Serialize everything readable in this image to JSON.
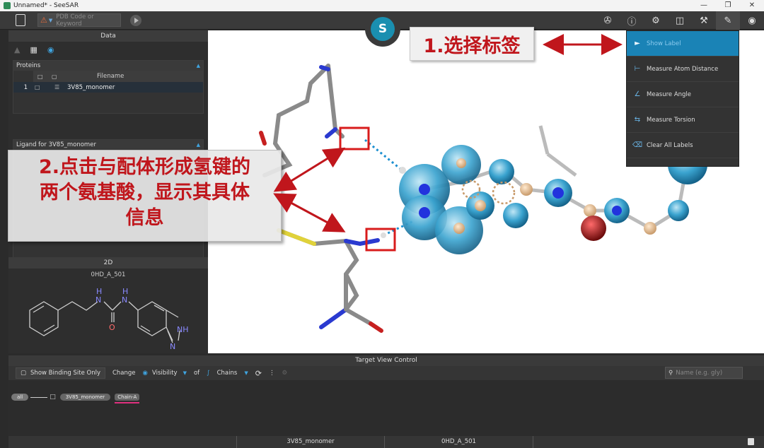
{
  "window": {
    "title": "Unnamed* - SeeSAR"
  },
  "toolbar": {
    "search_placeholder": "PDB Code or Keyword",
    "center_logo_glyph": "S"
  },
  "data_panel": {
    "header": "Data",
    "proteins": {
      "title": "Proteins",
      "col_filename": "Filename",
      "rows": [
        {
          "index": "1",
          "filename": "3V85_monomer"
        }
      ]
    },
    "ligand": {
      "title": "Ligand for 3V85_monomer"
    }
  },
  "twod_panel": {
    "header": "2D",
    "molecule_name": "0HD_A_501",
    "atoms": {
      "n1": "N",
      "h1": "H",
      "n2": "N",
      "h2": "H",
      "o": "O",
      "nh": "NH",
      "n3": "N"
    }
  },
  "menu": {
    "items": [
      {
        "label": "Show Label",
        "icon": "tag-icon",
        "selected": true
      },
      {
        "label": "Measure Atom Distance",
        "icon": "ruler-icon"
      },
      {
        "label": "Measure Angle",
        "icon": "angle-icon"
      },
      {
        "label": "Measure Torsion",
        "icon": "torsion-icon"
      },
      {
        "label": "Clear All Labels",
        "icon": "trash-icon"
      }
    ]
  },
  "target_view_control": {
    "header": "Target View Control",
    "show_binding_site_only": "Show Binding Site Only",
    "change": "Change",
    "visibility": "Visibility",
    "of": "of",
    "chains": "Chains",
    "search_placeholder": "Name (e.g. gly)",
    "tree": {
      "all": "all",
      "protein": "3V85_monomer",
      "chain": "Chain-A"
    }
  },
  "status_bar": {
    "protein": "3V85_monomer",
    "ligand": "0HD_A_501"
  },
  "annotations": {
    "step1": "1.选择标签",
    "step2_line1": "2.点击与配体形成氢键的",
    "step2_line2": "两个氨基酸，显示其具体",
    "step2_line3": "信息"
  },
  "colors": {
    "accent": "#1a83b6",
    "annotation_red": "#c0161c",
    "hbond": "#1b8fd0"
  }
}
